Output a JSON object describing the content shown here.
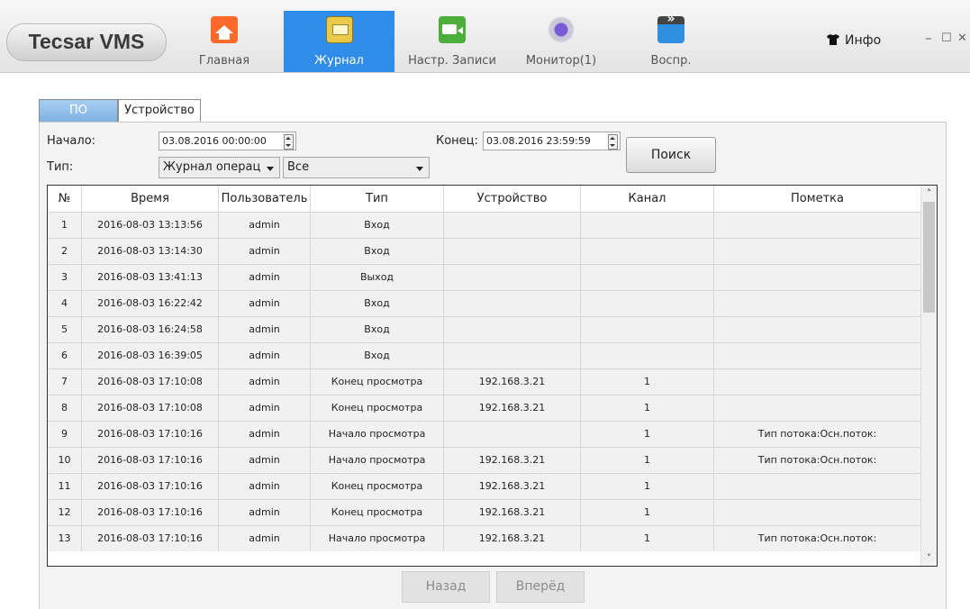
{
  "app": {
    "logo": "Tecsar VMS"
  },
  "nav": [
    {
      "label": "Главная",
      "icon": "home-icon"
    },
    {
      "label": "Журнал",
      "icon": "journal-icon",
      "active": true
    },
    {
      "label": "Настр. Записи",
      "icon": "record-settings-icon"
    },
    {
      "label": "Монитор(1)",
      "icon": "monitor-icon"
    },
    {
      "label": "Воспр.",
      "icon": "playback-icon"
    }
  ],
  "header": {
    "info_label": "Инфо",
    "minimize": "–",
    "maximize": "☐",
    "close": "✕"
  },
  "tabs": [
    "ПО",
    "Устройство"
  ],
  "filters": {
    "start_label": "Начало:",
    "start_value": "03.08.2016 00:00:00",
    "end_label": "Конец:",
    "end_value": "03.08.2016 23:59:59",
    "type_label": "Тип:",
    "type_value": "Журнал операц",
    "subtype_value": "Все",
    "search_label": "Поиск"
  },
  "table": {
    "columns": [
      "№",
      "Время",
      "Пользователь",
      "Тип",
      "Устройство",
      "Канал",
      "Пометка"
    ],
    "rows": [
      [
        "1",
        "2016-08-03 13:13:56",
        "admin",
        "Вход",
        "",
        "",
        ""
      ],
      [
        "2",
        "2016-08-03 13:14:30",
        "admin",
        "Вход",
        "",
        "",
        ""
      ],
      [
        "3",
        "2016-08-03 13:41:13",
        "admin",
        "Выход",
        "",
        "",
        ""
      ],
      [
        "4",
        "2016-08-03 16:22:42",
        "admin",
        "Вход",
        "",
        "",
        ""
      ],
      [
        "5",
        "2016-08-03 16:24:58",
        "admin",
        "Вход",
        "",
        "",
        ""
      ],
      [
        "6",
        "2016-08-03 16:39:05",
        "admin",
        "Вход",
        "",
        "",
        ""
      ],
      [
        "7",
        "2016-08-03 17:10:08",
        "admin",
        "Конец просмотра",
        "192.168.3.21",
        "1",
        ""
      ],
      [
        "8",
        "2016-08-03 17:10:08",
        "admin",
        "Конец просмотра",
        "192.168.3.21",
        "1",
        ""
      ],
      [
        "9",
        "2016-08-03 17:10:16",
        "admin",
        "Начало просмотра",
        "",
        "1",
        "Тип потока:Осн.поток:"
      ],
      [
        "10",
        "2016-08-03 17:10:16",
        "admin",
        "Начало просмотра",
        "192.168.3.21",
        "1",
        "Тип потока:Осн.поток:"
      ],
      [
        "11",
        "2016-08-03 17:10:16",
        "admin",
        "Конец просмотра",
        "192.168.3.21",
        "1",
        ""
      ],
      [
        "12",
        "2016-08-03 17:10:16",
        "admin",
        "Конец просмотра",
        "192.168.3.21",
        "1",
        ""
      ],
      [
        "13",
        "2016-08-03 17:10:16",
        "admin",
        "Начало просмотра",
        "192.168.3.21",
        "1",
        "Тип потока:Осн.поток:"
      ]
    ]
  },
  "pager": {
    "prev": "Назад",
    "next": "Вперёд"
  }
}
